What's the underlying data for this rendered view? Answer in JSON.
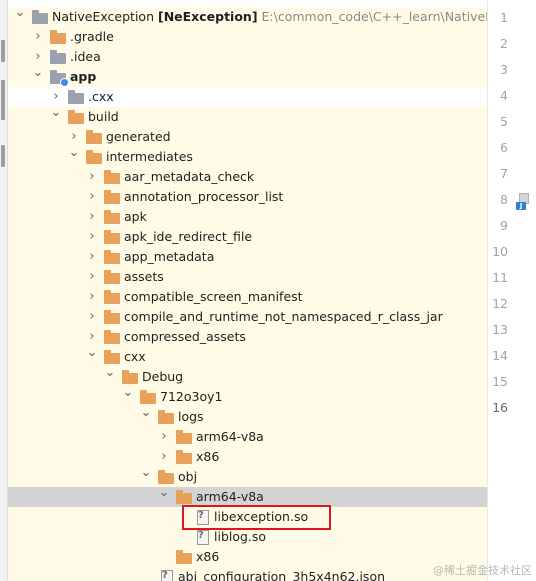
{
  "project_tree": {
    "root_name": "NativeException",
    "root_module": "[NeException]",
    "root_path": "E:\\common_code\\C++_learn\\NativeExcept",
    "items": [
      {
        "label": "NativeException",
        "arrow": "down",
        "icon": "folder-gray",
        "highlighted": true
      },
      {
        "label": ".gradle",
        "arrow": "right",
        "icon": "folder-orange",
        "highlighted": true
      },
      {
        "label": ".idea",
        "arrow": "right",
        "icon": "folder-gray",
        "highlighted": true
      },
      {
        "label": "app",
        "arrow": "down",
        "icon": "folder-gray-module",
        "highlighted": true,
        "bold": true
      },
      {
        "label": ".cxx",
        "arrow": "right",
        "icon": "folder-gray",
        "highlighted": false
      },
      {
        "label": "build",
        "arrow": "down",
        "icon": "folder-orange",
        "highlighted": true
      },
      {
        "label": "generated",
        "arrow": "right",
        "icon": "folder-orange",
        "highlighted": true
      },
      {
        "label": "intermediates",
        "arrow": "down",
        "icon": "folder-orange",
        "highlighted": true
      },
      {
        "label": "aar_metadata_check",
        "arrow": "right",
        "icon": "folder-orange",
        "highlighted": true
      },
      {
        "label": "annotation_processor_list",
        "arrow": "right",
        "icon": "folder-orange",
        "highlighted": true
      },
      {
        "label": "apk",
        "arrow": "right",
        "icon": "folder-orange",
        "highlighted": true
      },
      {
        "label": "apk_ide_redirect_file",
        "arrow": "right",
        "icon": "folder-orange",
        "highlighted": true
      },
      {
        "label": "app_metadata",
        "arrow": "right",
        "icon": "folder-orange",
        "highlighted": true
      },
      {
        "label": "assets",
        "arrow": "right",
        "icon": "folder-orange",
        "highlighted": true
      },
      {
        "label": "compatible_screen_manifest",
        "arrow": "right",
        "icon": "folder-orange",
        "highlighted": true
      },
      {
        "label": "compile_and_runtime_not_namespaced_r_class_jar",
        "arrow": "right",
        "icon": "folder-orange",
        "highlighted": true
      },
      {
        "label": "compressed_assets",
        "arrow": "right",
        "icon": "folder-orange",
        "highlighted": true
      },
      {
        "label": "cxx",
        "arrow": "down",
        "icon": "folder-orange",
        "highlighted": true
      },
      {
        "label": "Debug",
        "arrow": "down",
        "icon": "folder-orange",
        "highlighted": true
      },
      {
        "label": "712o3oy1",
        "arrow": "down",
        "icon": "folder-orange",
        "highlighted": true
      },
      {
        "label": "logs",
        "arrow": "down",
        "icon": "folder-orange",
        "highlighted": true
      },
      {
        "label": "arm64-v8a",
        "arrow": "right",
        "icon": "folder-orange",
        "highlighted": true
      },
      {
        "label": "x86",
        "arrow": "right",
        "icon": "folder-orange",
        "highlighted": true
      },
      {
        "label": "obj",
        "arrow": "down",
        "icon": "folder-orange",
        "highlighted": true
      },
      {
        "label": "arm64-v8a",
        "arrow": "down",
        "icon": "folder-orange",
        "selected": true
      },
      {
        "label": "libexception.so",
        "arrow": "",
        "icon": "file-unknown",
        "highlighted": true
      },
      {
        "label": "liblog.so",
        "arrow": "",
        "icon": "file-unknown",
        "highlighted": true
      },
      {
        "label": "x86",
        "arrow": "",
        "icon": "folder-orange",
        "highlighted": true
      },
      {
        "label": "abi_configuration_3h5x4n62.json",
        "arrow": "",
        "icon": "file-unknown",
        "highlighted": true
      }
    ]
  },
  "gutter": {
    "line_numbers": [
      "1",
      "2",
      "3",
      "4",
      "5",
      "6",
      "7",
      "8",
      "9",
      "10",
      "11",
      "12",
      "13",
      "14",
      "15",
      "16"
    ],
    "current_line": "16",
    "bookmark_line": "8",
    "bookmark_badge": "J"
  },
  "watermark": "@稀土掘金技术社区",
  "colors": {
    "row_highlight": "#fffbe6",
    "row_selected": "#d4d4d4",
    "folder_orange": "#e8a15a",
    "folder_gray": "#9aa3ad",
    "annotation_box": "#e0141c"
  }
}
